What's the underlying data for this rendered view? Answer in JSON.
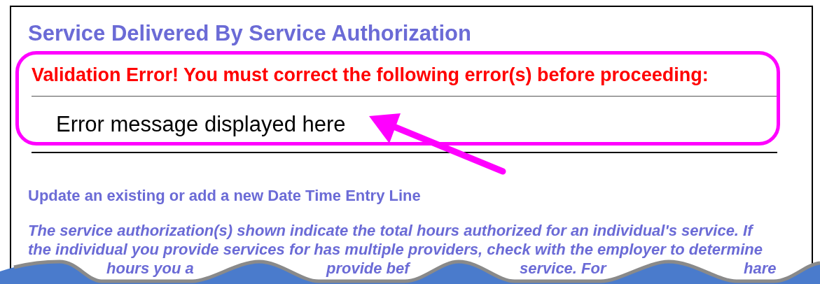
{
  "page": {
    "title": "Service Delivered By Service Authorization"
  },
  "validation": {
    "heading": "Validation Error! You must correct the following error(s) before proceeding:",
    "message": "Error message displayed here"
  },
  "section": {
    "heading": "Update an existing or add a new Date Time Entry Line",
    "lines": [
      "The service authorization(s) shown indicate the total hours authorized for an individual's service. If",
      "the individual you provide services for has multiple providers, check with the employer to determine"
    ],
    "partial_line": [
      "hours you a",
      "provide bef",
      "service. For",
      "hare"
    ]
  }
}
